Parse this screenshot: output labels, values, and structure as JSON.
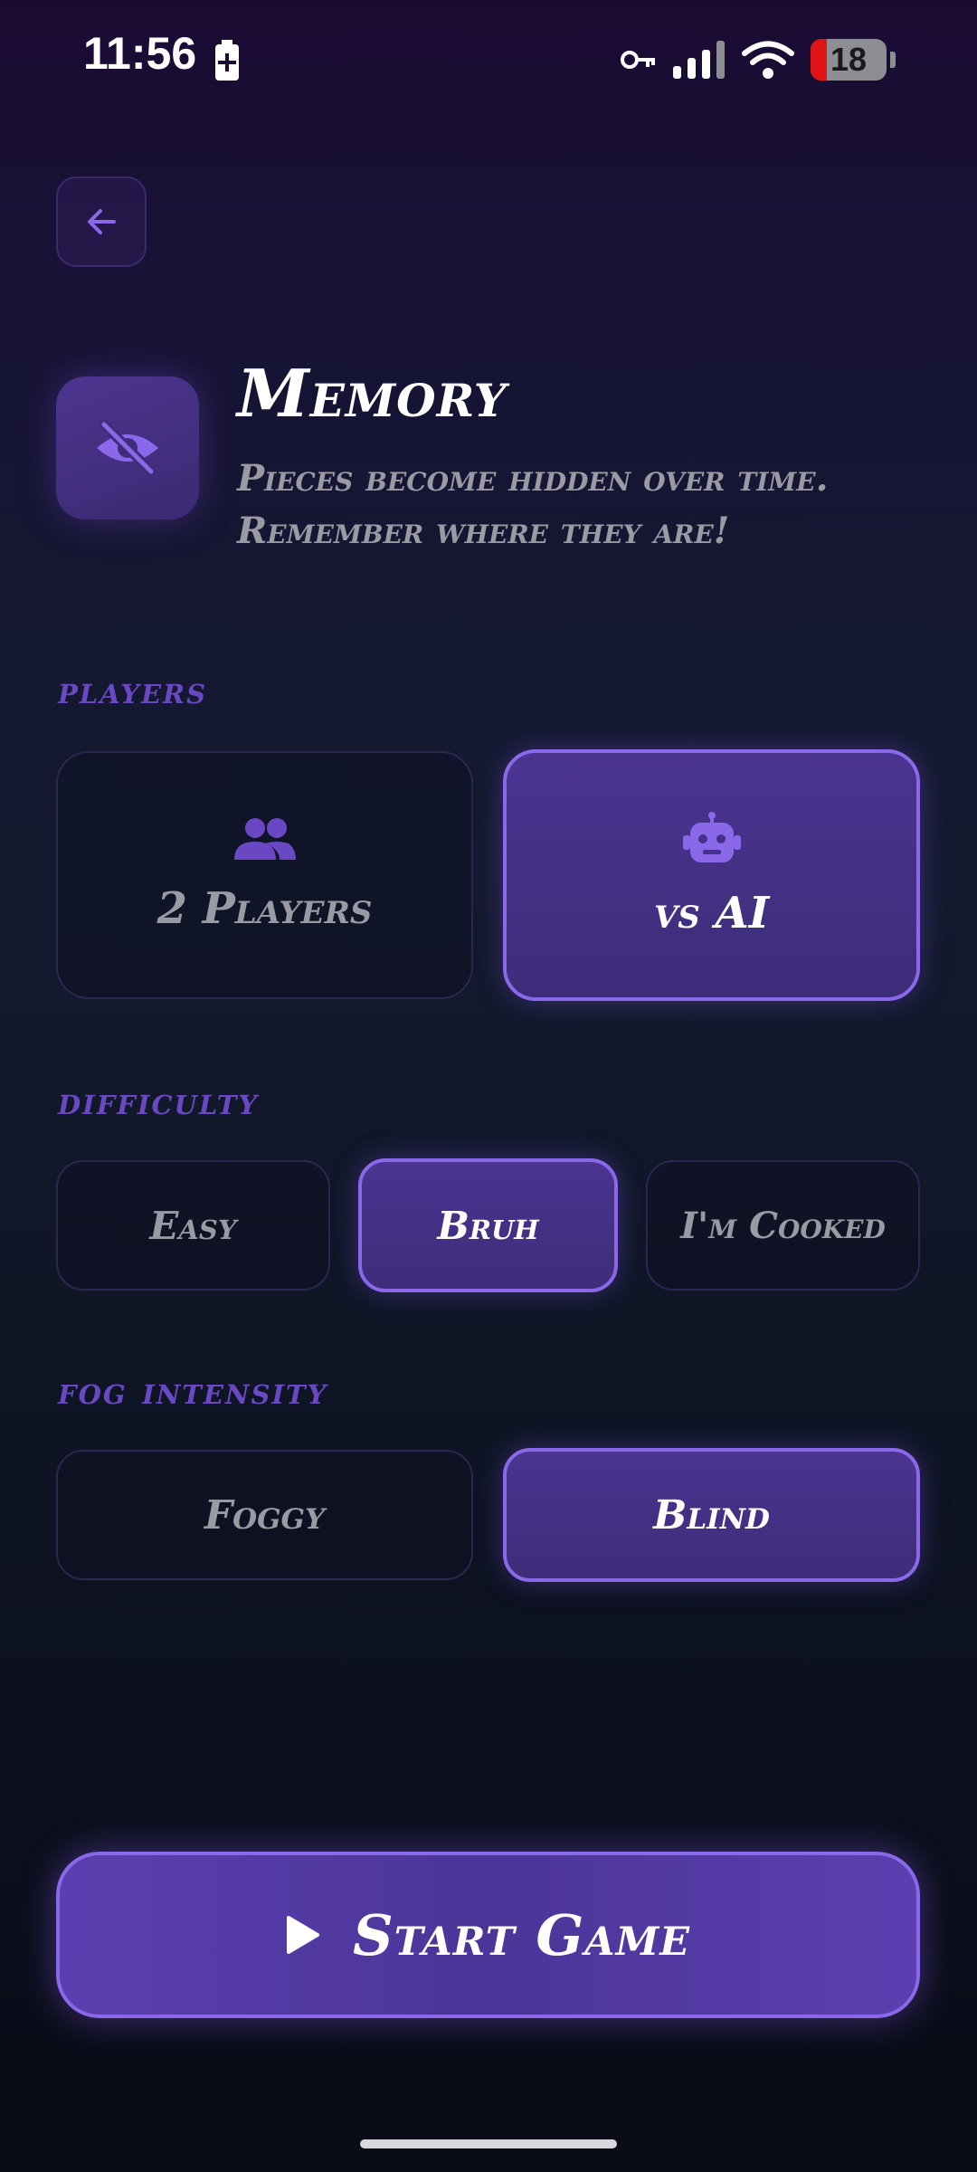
{
  "status_bar": {
    "time": "11:56",
    "battery_level": "18",
    "icons": [
      "battery-saver-icon",
      "vpn-key-icon",
      "signal-icon",
      "wifi-icon",
      "battery-icon"
    ]
  },
  "header": {
    "back_icon": "arrow-left-icon",
    "mode_icon": "eye-off-icon",
    "title": "Memory",
    "description": "Pieces become hidden over time. Remember where they are!"
  },
  "players": {
    "label": "players",
    "options": [
      {
        "label": "2 Players",
        "icon": "people-icon",
        "selected": false
      },
      {
        "label": "vs AI",
        "icon": "robot-icon",
        "selected": true
      }
    ]
  },
  "difficulty": {
    "label": "difficulty",
    "options": [
      {
        "label": "Easy",
        "selected": false
      },
      {
        "label": "Bruh",
        "selected": true
      },
      {
        "label": "I'm Cooked",
        "selected": false
      }
    ]
  },
  "fog": {
    "label": "fog intensity",
    "options": [
      {
        "label": "Foggy",
        "selected": false
      },
      {
        "label": "Blind",
        "selected": true
      }
    ]
  },
  "start": {
    "label": "Start Game",
    "icon": "play-icon"
  },
  "colors": {
    "accent": "#8b67ea",
    "section_label": "#6a48c4",
    "muted_text": "#9a9aa3"
  }
}
